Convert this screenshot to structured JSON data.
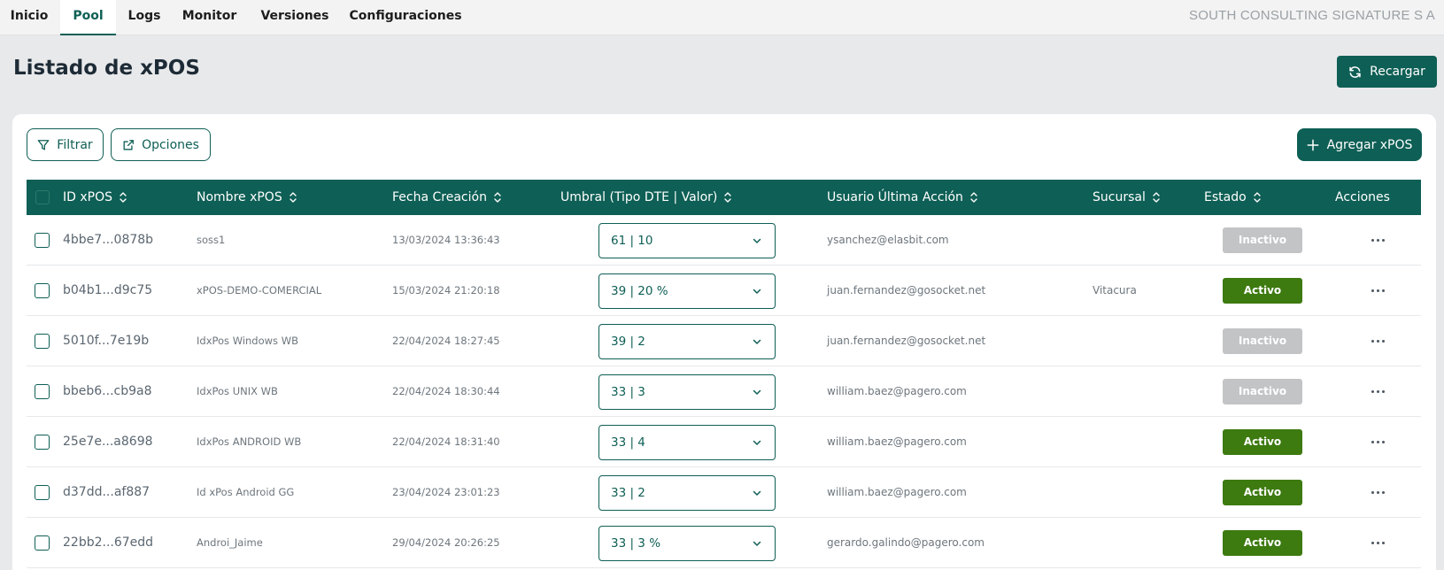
{
  "nav": {
    "tabs": [
      {
        "label": "Inicio",
        "active": false
      },
      {
        "label": "Pool",
        "active": true
      },
      {
        "label": "Logs",
        "active": false
      },
      {
        "label": "Monitor",
        "active": false
      },
      {
        "label": "Versiones",
        "active": false
      },
      {
        "label": "Configuraciones",
        "active": false
      }
    ],
    "company": "SOUTH CONSULTING SIGNATURE S A"
  },
  "header": {
    "title": "Listado de xPOS",
    "reload_label": "Recargar"
  },
  "toolbar": {
    "filter_label": "Filtrar",
    "options_label": "Opciones",
    "add_label": "Agregar xPOS"
  },
  "table": {
    "columns": {
      "id": "ID xPOS",
      "name": "Nombre xPOS",
      "date": "Fecha Creación",
      "umbral": "Umbral (Tipo DTE | Valor)",
      "user": "Usuario Última Acción",
      "branch": "Sucursal",
      "state": "Estado",
      "actions": "Acciones"
    },
    "rows": [
      {
        "id": "4bbe7...0878b",
        "name": "soss1",
        "date": "13/03/2024 13:36:43",
        "umbral": "61 | 10",
        "user": "ysanchez@elasbit.com",
        "branch": "",
        "state": "Inactivo",
        "active": false
      },
      {
        "id": "b04b1...d9c75",
        "name": "xPOS-DEMO-COMERCIAL",
        "date": "15/03/2024 21:20:18",
        "umbral": "39 | 20 %",
        "user": "juan.fernandez@gosocket.net",
        "branch": "Vitacura",
        "state": "Activo",
        "active": true
      },
      {
        "id": "5010f...7e19b",
        "name": "IdxPos Windows WB",
        "date": "22/04/2024 18:27:45",
        "umbral": "39 | 2",
        "user": "juan.fernandez@gosocket.net",
        "branch": "",
        "state": "Inactivo",
        "active": false
      },
      {
        "id": "bbeb6...cb9a8",
        "name": "IdxPos UNIX WB",
        "date": "22/04/2024 18:30:44",
        "umbral": "33 | 3",
        "user": "william.baez@pagero.com",
        "branch": "",
        "state": "Inactivo",
        "active": false
      },
      {
        "id": "25e7e...a8698",
        "name": "IdxPos ANDROID WB",
        "date": "22/04/2024 18:31:40",
        "umbral": "33 | 4",
        "user": "william.baez@pagero.com",
        "branch": "",
        "state": "Activo",
        "active": true
      },
      {
        "id": "d37dd...af887",
        "name": "Id xPos Android GG",
        "date": "23/04/2024 23:01:23",
        "umbral": "33 | 2",
        "user": "william.baez@pagero.com",
        "branch": "",
        "state": "Activo",
        "active": true
      },
      {
        "id": "22bb2...67edd",
        "name": "Androi_Jaime",
        "date": "29/04/2024 20:26:25",
        "umbral": "33 | 3 %",
        "user": "gerardo.galindo@pagero.com",
        "branch": "",
        "state": "Activo",
        "active": true
      }
    ]
  },
  "colors": {
    "brand": "#0e5f55",
    "active": "#3d7a10",
    "inactive": "#c2c4c6"
  }
}
